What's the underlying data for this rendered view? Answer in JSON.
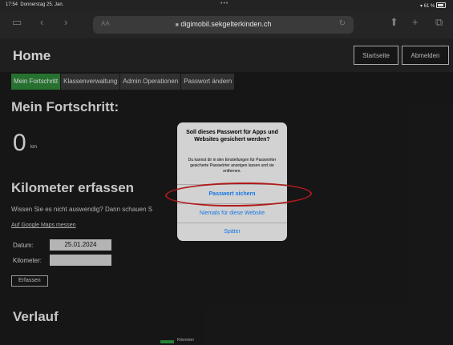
{
  "status_bar": {
    "time": "17:54",
    "date": "Donnerstag 25. Jan.",
    "battery": "61 %",
    "center_dots": "•••"
  },
  "browser": {
    "url": "digimobil.sekgelterkinden.ch",
    "text_size_label": "AA",
    "icons": [
      "sidebar-icon",
      "back-icon",
      "forward-icon",
      "reload-icon",
      "share-icon",
      "new-tab-icon",
      "tabs-icon"
    ]
  },
  "header": {
    "title": "Home",
    "buttons": [
      "Startseite",
      "Abmelden"
    ]
  },
  "tabs": [
    {
      "label": "Mein Fortschritt",
      "active": true
    },
    {
      "label": "Klassenverwaltung",
      "active": false
    },
    {
      "label": "Admin Operationen",
      "active": false
    },
    {
      "label": "Passwort ändern",
      "active": false
    }
  ],
  "progress": {
    "heading": "Mein Fortschritt:",
    "value": "0",
    "unit": "km"
  },
  "record": {
    "heading": "Kilometer erfassen",
    "hint": "Wissen Sie es nicht auswendig? Dann schauen S",
    "maps_link": "Auf Google Maps messen",
    "date_label": "Datum:",
    "date_value": "25.01.2024",
    "km_label": "Kilometer:",
    "km_value": "",
    "submit": "Erfassen"
  },
  "history": {
    "heading": "Verlauf",
    "legend": "Kilometer",
    "legend_color": "#2f9e44"
  },
  "dialog": {
    "title": "Soll dieses Passwort für Apps und Websites gesichert werden?",
    "message": "Du kannst dir in den Einstellungen für Passwörter gesicherte Passwörter anzeigen lassen und sie entfernen.",
    "buttons": [
      "Passwort sichern",
      "Niemals für diese Website",
      "Später"
    ],
    "button_color": "#1676e4",
    "highlight_color": "#b01b1b"
  }
}
